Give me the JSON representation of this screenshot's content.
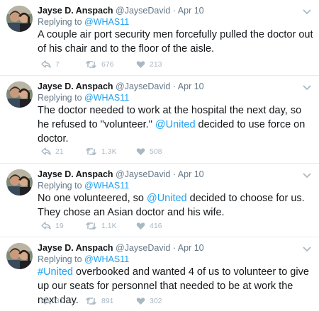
{
  "tweets": [
    {
      "name": "Jayse D. Anspach",
      "handle": "@JayseDavid",
      "dot": "·",
      "time": "Apr 10",
      "replying_prefix": "Replying to",
      "replying_to": "@WHAS11",
      "text_parts": [
        "A couple air port security men forcefully pulled the doctor out of his chair and to the floor of the aisle."
      ],
      "replies": "7",
      "retweets": "676",
      "likes": "213"
    },
    {
      "name": "Jayse D. Anspach",
      "handle": "@JayseDavid",
      "dot": "·",
      "time": "Apr 10",
      "replying_prefix": "Replying to",
      "replying_to": "@WHAS11",
      "text_parts": [
        "The doctor needed to work at the hospital the next day, so he refused to \"volunteer.\" ",
        "@United",
        " decided to use force on doctor."
      ],
      "replies": "21",
      "retweets": "1.3K",
      "likes": "508"
    },
    {
      "name": "Jayse D. Anspach",
      "handle": "@JayseDavid",
      "dot": "·",
      "time": "Apr 10",
      "replying_prefix": "Replying to",
      "replying_to": "@WHAS11",
      "text_parts": [
        "No one volunteered, so ",
        "@United",
        " decided to choose for us. They chose an Asian doctor and his wife."
      ],
      "replies": "19",
      "retweets": "1.1K",
      "likes": "416"
    },
    {
      "name": "Jayse D. Anspach",
      "handle": "@JayseDavid",
      "dot": "·",
      "time": "Apr 10",
      "replying_prefix": "Replying to",
      "replying_to": "@WHAS11",
      "text_parts": [
        "",
        "#United",
        " overbooked and wanted 4 of us to volunteer to give up our seats for personnel that needed to be at work the next day."
      ],
      "replies": "31",
      "retweets": "891",
      "likes": "302"
    }
  ],
  "icons": {
    "reply": "reply-icon",
    "retweet": "retweet-icon",
    "like": "heart-icon",
    "menu": "chevron-down-icon"
  },
  "colors": {
    "link": "#1da1f2",
    "muted": "#657786",
    "icon": "#aab8c2",
    "divider": "#e6ecf0"
  }
}
